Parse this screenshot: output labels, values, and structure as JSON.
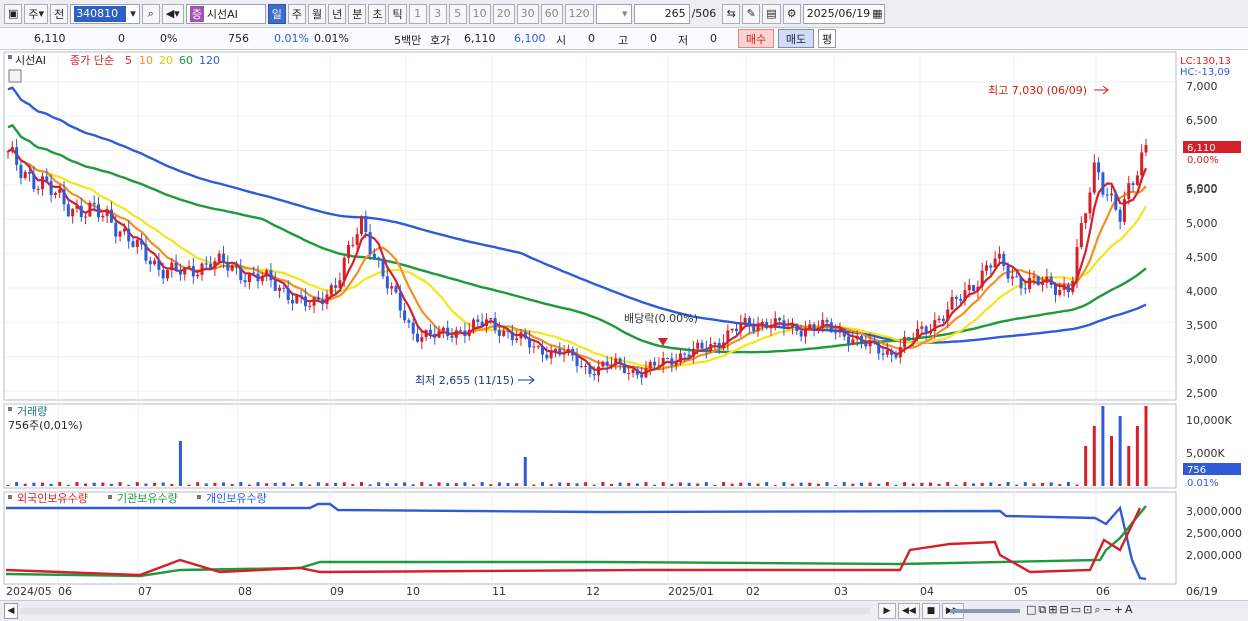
{
  "toolbar": {
    "type_label": "주",
    "prev_label": "전",
    "code": "340810",
    "name_badge": "증",
    "name": "시선AI",
    "periods": [
      "일",
      "주",
      "월",
      "년",
      "분",
      "초",
      "틱"
    ],
    "selected_period": "일",
    "minutes": [
      "1",
      "3",
      "5",
      "10",
      "20",
      "30",
      "60",
      "120"
    ],
    "count": "265",
    "total": "/506",
    "date": "2025/06/19"
  },
  "quote": {
    "price": "6,110",
    "change": "0",
    "change_pct": "0%",
    "volume": "756",
    "vol_pct": "0.01%",
    "vol_pct2": "0.01%",
    "unit": "5백만",
    "quote_label": "호가",
    "ask": "6,110",
    "bid": "6,100",
    "open_label": "시",
    "open": "0",
    "high_label": "고",
    "high": "0",
    "low_label": "저",
    "low": "0",
    "buy_label": "매수",
    "sell_label": "매도",
    "avg_label": "평"
  },
  "price_panel": {
    "title": "시선AI",
    "ma_label": "종가 단순",
    "ma_periods": [
      "5",
      "10",
      "20",
      "60",
      "120"
    ],
    "lc": "LC:130,13",
    "hc": "HC:-13,09",
    "current": "6,110",
    "current_pct": "0,00%",
    "high_note": "최고 7,030 (06/09)",
    "low_note": "최저 2,655 (11/15)",
    "dividend_note": "배당락(0.00%)",
    "y_ticks": [
      "7,000",
      "6,500",
      "6,000",
      "5,500",
      "5,000",
      "4,500",
      "4,000",
      "3,500",
      "3,000",
      "2,500"
    ]
  },
  "volume_panel": {
    "title": "거래량",
    "value": "756주(0,01%)",
    "y_ticks": [
      "10,000K",
      "5,000K"
    ],
    "current": "756",
    "current_pct": "0.01%"
  },
  "holding_panel": {
    "series": [
      "외국인보유수량",
      "기관보유수량",
      "개인보유수량"
    ],
    "y_ticks": [
      "3,000,000",
      "2,500,000",
      "2,000,000"
    ]
  },
  "x_axis": [
    "2024/05",
    "06",
    "07",
    "08",
    "09",
    "10",
    "11",
    "12",
    "2025/01",
    "02",
    "03",
    "04",
    "05",
    "06",
    "06/19"
  ],
  "colors": {
    "ma5": "#d4202a",
    "ma10": "#f4901e",
    "ma20": "#f5e617",
    "ma60": "#1e9a3c",
    "ma120": "#2f5bd6",
    "up": "#d4202a",
    "down": "#2f5bd6"
  },
  "chart_data": {
    "type": "candlestick",
    "approx_close": [
      5900,
      5600,
      5300,
      5100,
      5050,
      4600,
      4300,
      4200,
      4400,
      4250,
      4150,
      3950,
      3700,
      4100,
      4950,
      4050,
      3350,
      3300,
      3400,
      3500,
      3300,
      3100,
      3050,
      2800,
      2900,
      2750,
      2950,
      3050,
      3200,
      3450,
      3500,
      3400,
      3450,
      3350,
      3150,
      3050,
      3350,
      3600,
      4000,
      4400,
      4100,
      4050,
      4000,
      5800,
      5000,
      6110
    ],
    "ylim": [
      2400,
      7200
    ]
  }
}
